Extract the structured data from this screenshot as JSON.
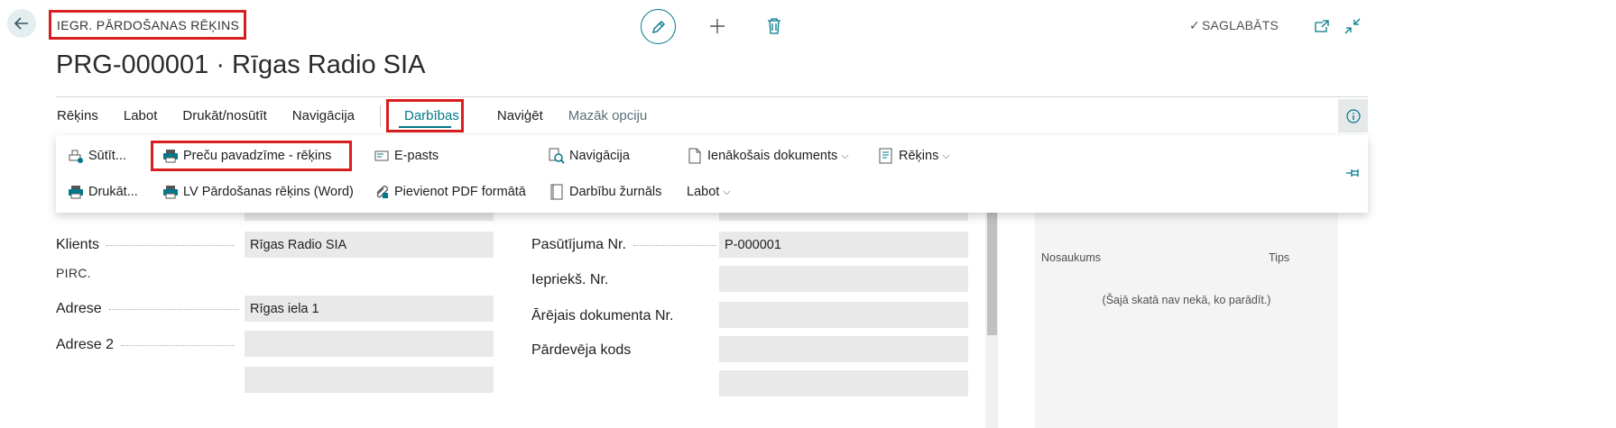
{
  "header": {
    "caption": "IEGR. PĀRDOŠANAS RĒĶINS",
    "title": "PRG-000001 · Rīgas Radio SIA",
    "saved_status": "SAGLABĀTS"
  },
  "action_bar": {
    "items": [
      "Rēķins",
      "Labot",
      "Drukāt/nosūtīt",
      "Navigācija"
    ],
    "active": "Darbības",
    "after_active": "Naviģēt",
    "less_options": "Mazāk opciju"
  },
  "panel": {
    "row1": [
      {
        "label": "Sūtīt...",
        "icon": "send-print-icon"
      },
      {
        "label": "Preču pavadzīme - rēķins",
        "icon": "printer-icon"
      },
      {
        "label": "E-pasts",
        "icon": "email-icon"
      },
      {
        "label": "Navigācija",
        "icon": "find-entries-icon"
      },
      {
        "label": "Ienākošais dokuments",
        "icon": "document-icon",
        "dropdown": true
      },
      {
        "label": "Rēķins",
        "icon": "invoice-icon",
        "dropdown": true
      }
    ],
    "row2": [
      {
        "label": "Drukāt...",
        "icon": "printer-icon"
      },
      {
        "label": "LV Pārdošanas rēķins (Word)",
        "icon": "printer-icon"
      },
      {
        "label": "Pievienot PDF formātā",
        "icon": "attach-icon"
      },
      {
        "label": "Darbību žurnāls",
        "icon": "log-icon"
      },
      {
        "label": "Labot",
        "dropdown": true
      }
    ]
  },
  "form": {
    "left": [
      {
        "label": "Klients",
        "value": "Rīgas Radio SIA"
      },
      {
        "label": "Adrese",
        "value": "Rīgas iela 1"
      },
      {
        "label": "Adrese 2",
        "value": ""
      }
    ],
    "section_caption": "PIRC.",
    "right": [
      {
        "label": "Pasūtījuma Nr.",
        "value": "P-000001"
      },
      {
        "label": "Iepriekš. Nr.",
        "value": ""
      },
      {
        "label": "Ārējais dokumenta Nr.",
        "value": ""
      },
      {
        "label": "Pārdevēja kods",
        "value": ""
      }
    ]
  },
  "factbox": {
    "col_name": "Nosaukums",
    "col_type": "Tips",
    "empty_text": "(Šajā skatā nav nekā, ko parādīt.)"
  },
  "colors": {
    "accent": "#00788a",
    "highlight": "#d81f1f"
  }
}
